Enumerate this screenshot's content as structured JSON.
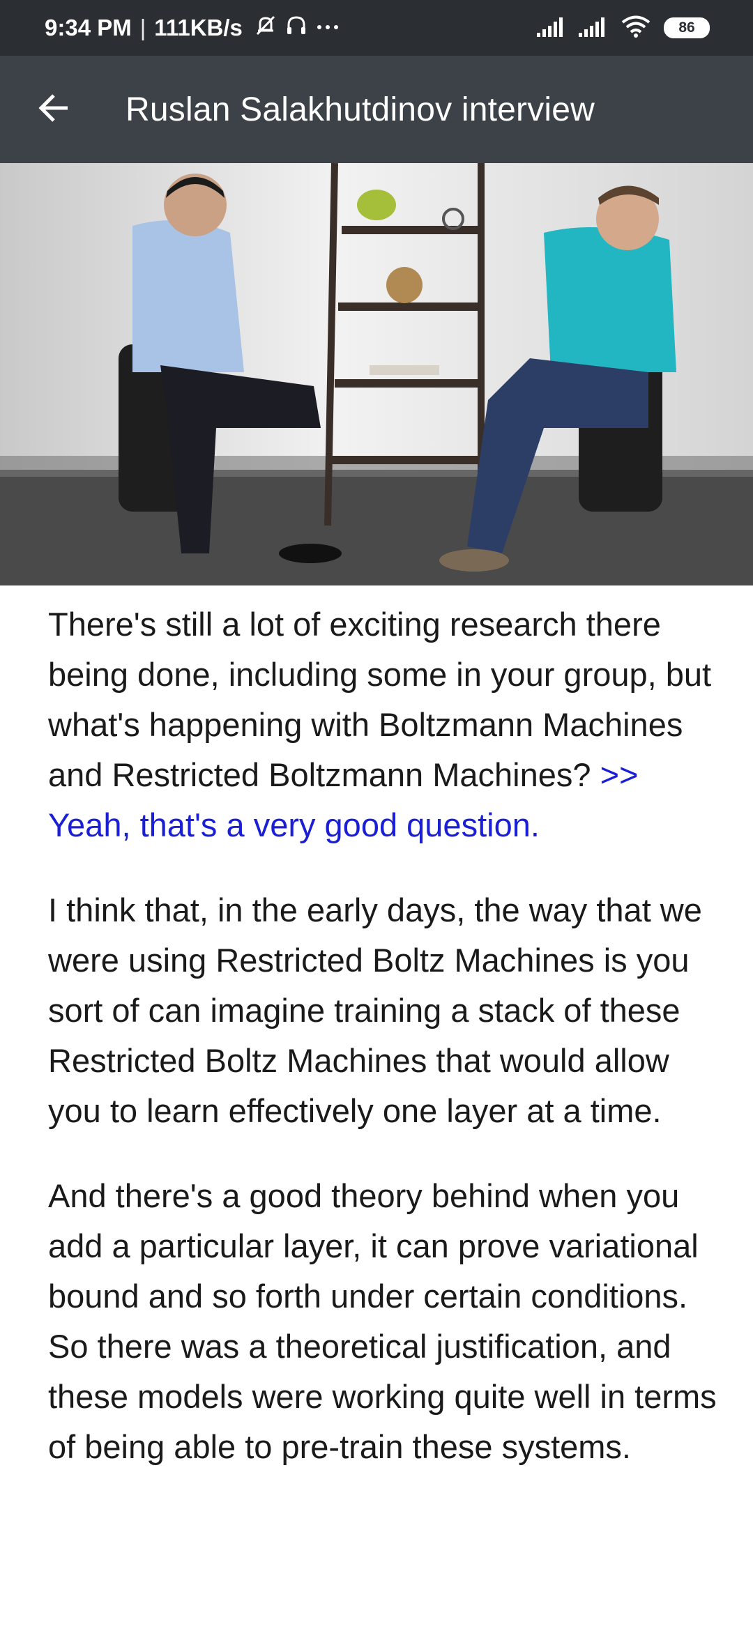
{
  "status_bar": {
    "time": "9:34 PM",
    "separator": "|",
    "network_speed": "111KB/s",
    "icons": [
      "mute-bell-icon",
      "headphones-icon",
      "more-dots-icon",
      "signal-icon",
      "signal-icon",
      "wifi-icon"
    ],
    "battery": "86"
  },
  "app_bar": {
    "back_icon": "arrow-left-icon",
    "title": "Ruslan Salakhutdinov interview"
  },
  "video": {
    "icon": "video-frame"
  },
  "transcript": {
    "p1_text": "There's still a lot of exciting research there being done, including some in your group, but what's happening with Boltzmann Machines and Restricted Boltzmann Machines? ",
    "p1_highlight": ">> Yeah, that's a very good question.",
    "p2_text": "I think that, in the early days, the way that we were using Restricted Boltz Machines is you sort of can imagine training a stack of these Restricted Boltz Machines that would allow you to learn effectively one layer at a time.",
    "p3_text": "And there's a good theory behind when you add a particular layer, it can prove variational bound and so forth under certain conditions. So there was a theoretical justification, and these models were working quite well in terms of being able to pre-train these systems."
  },
  "colors": {
    "status_bar_bg": "#2b2e33",
    "app_bar_bg": "#3d4248",
    "highlight_text": "#1a1fd6",
    "body_text": "#1a1a1a"
  }
}
